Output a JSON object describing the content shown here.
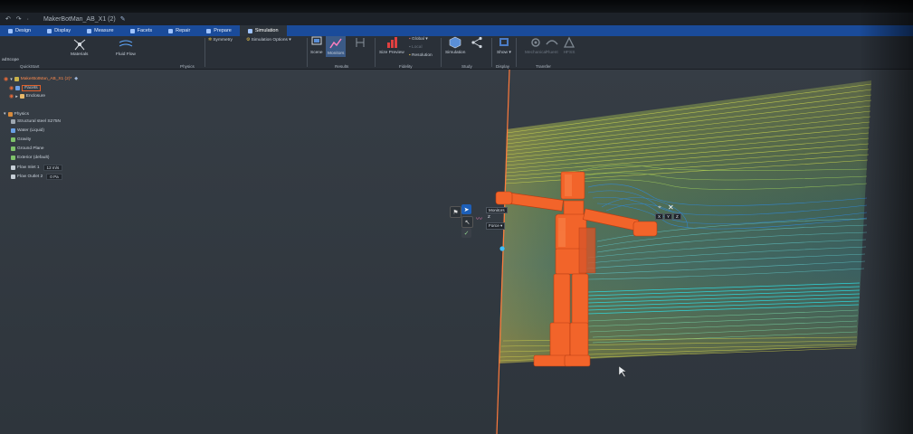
{
  "window": {
    "title": "MakerBotMan_AB_X1 (2)",
    "quick_access": "↶ ↷ ·"
  },
  "tabs": [
    {
      "label": "Design"
    },
    {
      "label": "Display"
    },
    {
      "label": "Measure"
    },
    {
      "label": "Facets"
    },
    {
      "label": "Repair"
    },
    {
      "label": "Prepare"
    },
    {
      "label": "Simulation"
    }
  ],
  "ribbon": {
    "left_clip_label": "adScope",
    "buttons": {
      "materials": "Materials",
      "fluid_flow": "Fluid Flow",
      "symmetry": "Symmetry",
      "simulation_options": "Simulation Options",
      "scene": "Scene",
      "monitors": "Monitors",
      "size_preview": "Size Preview",
      "global": "Global",
      "local": "Local",
      "resolution": "Resolution",
      "simulation": "Simulation",
      "show": "Show",
      "mechanical": "Mechanical",
      "fluent": "Fluent",
      "hfss": "HFSS"
    },
    "groups": {
      "quickstart": "QuickStart",
      "physics": "Physics",
      "results": "Results",
      "fidelity": "Fidelity",
      "study": "Study",
      "display": "Display",
      "transfer": "Transfer"
    }
  },
  "tree": {
    "root": "MakerBotMan_AB_X1 (2)*",
    "facets": "Facets",
    "enclosure": "Enclosure",
    "physics": "Physics",
    "items": [
      {
        "label": "Structural steel S275N"
      },
      {
        "label": "Water (Liquid)"
      },
      {
        "label": "Gravity"
      },
      {
        "label": "Ground Plane"
      },
      {
        "label": "Exterior (default)"
      },
      {
        "label": "Flow Inlet 1",
        "value": "12 m/s"
      },
      {
        "label": "Flow Outlet 2",
        "value": "0 Pa"
      }
    ]
  },
  "floating_toolbar": {
    "monitors_label": "Monitors",
    "axis": "Z",
    "force_select": "Force",
    "axis_labels": [
      "X",
      "Y",
      "Z"
    ]
  },
  "colors": {
    "ribbon_tab_bg": "#1a4b9a",
    "ribbon_bg": "#2a3038",
    "viewport_bg": "#333a42",
    "robot": "#f2642a",
    "inlet_line": "#ff7a3c",
    "highlight": "#e0602a"
  }
}
